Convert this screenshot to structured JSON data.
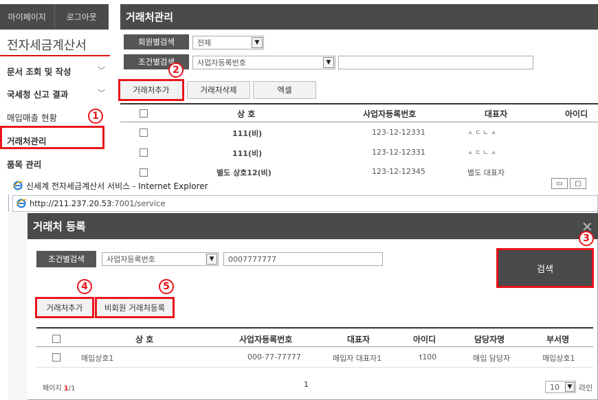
{
  "topbar": {
    "mypage": "마이페이지",
    "logout": "로그아웃"
  },
  "sidebar": {
    "title": "전자세금계산서",
    "items": [
      {
        "label": "문서 조회 및 작성",
        "chevron": "﹀"
      },
      {
        "label": "국세청 신고 결과",
        "chevron": "﹀"
      },
      {
        "label": "매입매출 현황"
      },
      {
        "label": "거래처관리"
      },
      {
        "label": "품목 관리"
      }
    ]
  },
  "main": {
    "title": "거래처관리",
    "member_search_label": "회원별검색",
    "member_search_value": "전체",
    "cond_search_label": "조건별검색",
    "cond_search_value": "사업자등록번호",
    "cond_search_input": "",
    "buttons": {
      "add": "거래처추가",
      "delete": "거래처삭제",
      "excel": "엑셀"
    },
    "table": {
      "headers": [
        "상 호",
        "사업자등록번호",
        "대표자",
        "아이디"
      ],
      "rows": [
        {
          "name": "111(비)",
          "bizno": "123-12-12331",
          "rep": "ㅅㄷㄴㅅ"
        },
        {
          "name": "111(비)",
          "bizno": "123-12-12331",
          "rep": "ㅅㄷㄴㅅ"
        },
        {
          "name": "별도 상호12(비)",
          "bizno": "123-12-12345",
          "rep": "별도 대표자"
        }
      ]
    }
  },
  "ie": {
    "title": "신세계 전자세금계산서 서비스 - Internet Explorer",
    "url_host": "http://211.237.20.53",
    "url_path": ":7001/service",
    "minimize": "▭",
    "maximize": "▢"
  },
  "dialog": {
    "title": "거래처 등록",
    "close": "✕",
    "cond_search_label": "조건별검색",
    "cond_select_value": "사업자등록번호",
    "search_input_value": "0007777777",
    "search_button": "검색",
    "add_button": "거래처추가",
    "nonmember_button": "비회원 거래처등록",
    "table": {
      "headers": [
        "상 호",
        "사업자등록번호",
        "대표자",
        "아이디",
        "담당자명",
        "부서명"
      ],
      "rows": [
        {
          "name": "매입상호1",
          "bizno": "000-77-77777",
          "rep": "매입자 대표자1",
          "id": "t100",
          "manager": "매입 담당자",
          "dept": "매입상호1"
        }
      ]
    },
    "pager": {
      "label": "페이지",
      "current": "1",
      "total": "/1",
      "page_number": "1",
      "per_page": "10",
      "per_page_suffix": "라인"
    }
  },
  "callouts": [
    "1",
    "2",
    "3",
    "4",
    "5"
  ],
  "colors": {
    "highlight": "#e8151b",
    "header_bg": "#4a4a4a"
  }
}
